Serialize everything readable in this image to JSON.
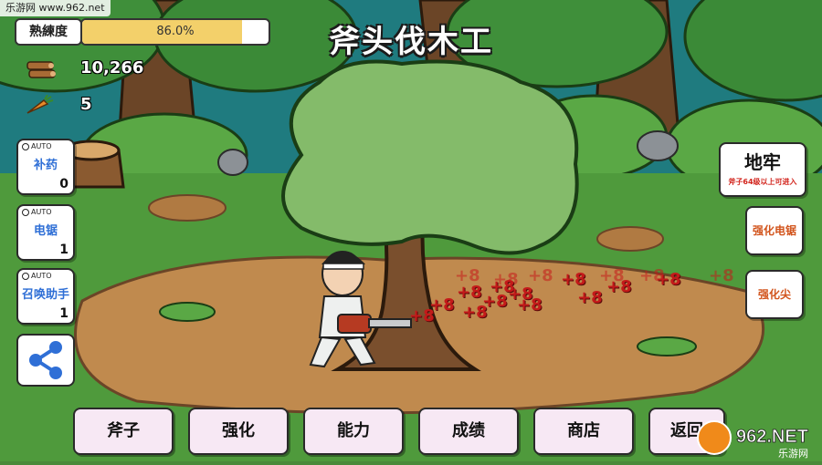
{
  "watermark": "乐游网 www.962.net",
  "proficiency": {
    "label": "熟練度",
    "value_text": "86.0%",
    "fraction": 0.86
  },
  "title": "斧头伐木工",
  "resources": {
    "wood": "10,266",
    "carrot": "5"
  },
  "auto_items": [
    {
      "tag": "AUTO",
      "name": "补药",
      "count": "0"
    },
    {
      "tag": "AUTO",
      "name": "电锯",
      "count": "1"
    },
    {
      "tag": "AUTO",
      "name": "召唤助手",
      "count": "1"
    }
  ],
  "right_panel": {
    "dungeon_title": "地牢",
    "dungeon_note": "斧子64级以上可进入",
    "strengthen_saw": "强化电锯",
    "strengthen_tip": "强化尖"
  },
  "menu": [
    "斧子",
    "强化",
    "能力",
    "成绩",
    "商店",
    "返回"
  ],
  "damage_popups": [
    "+8",
    "+8",
    "+8",
    "+8",
    "+8",
    "+8",
    "+8",
    "+8",
    "+8",
    "+8",
    "+8",
    "+8",
    "+8",
    "+8",
    "+8",
    "+8",
    "+8",
    "+8"
  ],
  "logo": {
    "main": "962.NET",
    "sub": "乐游网"
  },
  "colors": {
    "accent_blue": "#2f6fd6",
    "damage_red": "#c41a1a",
    "bar_fill": "#f3d06a",
    "menu_bg": "#f7e8f4"
  }
}
